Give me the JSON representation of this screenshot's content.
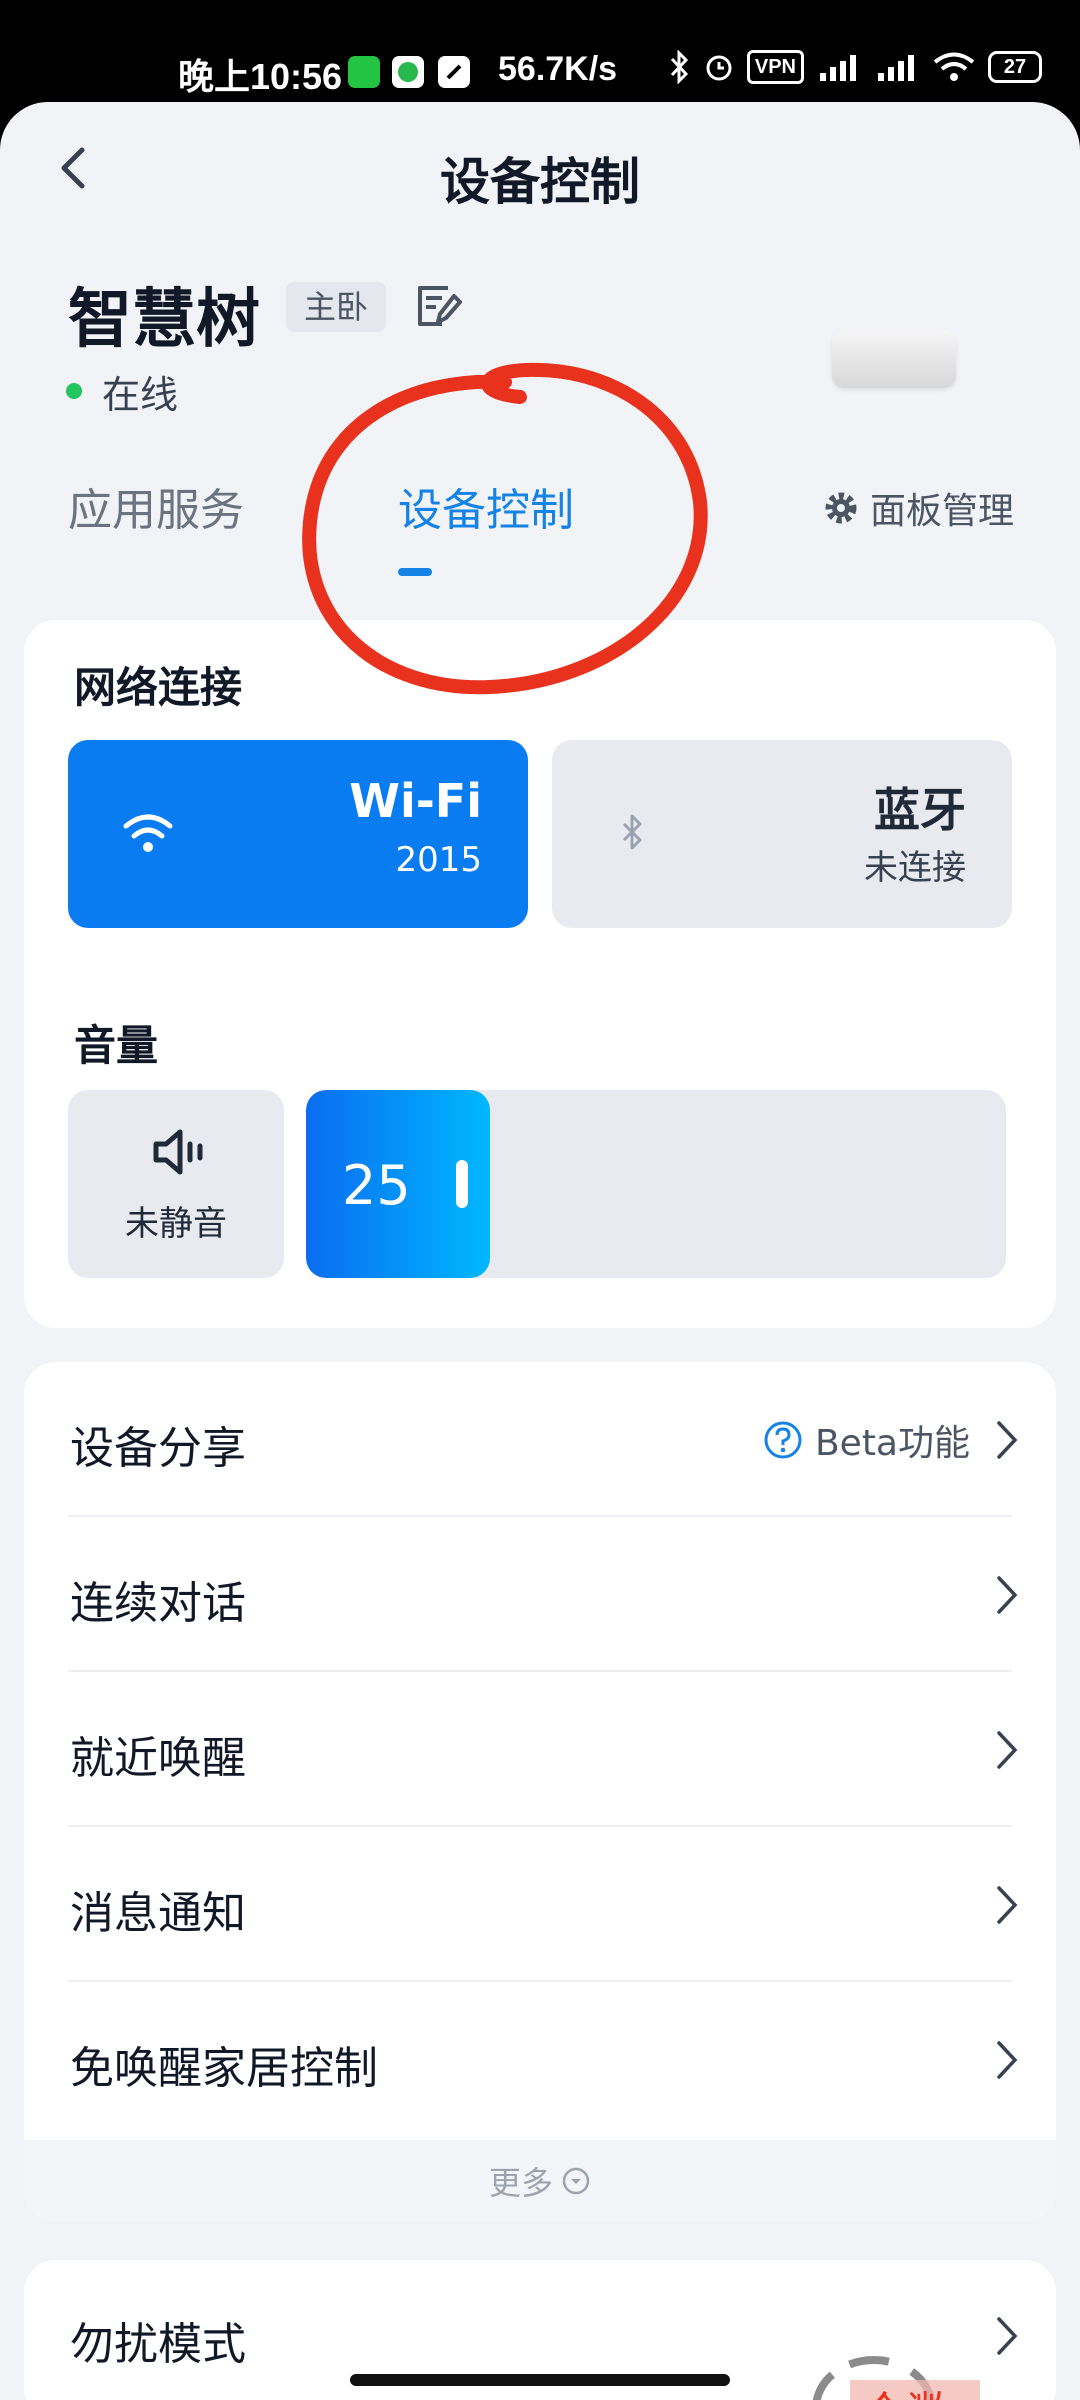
{
  "status_bar": {
    "time": "晚上10:56",
    "net_speed": "56.7K/s",
    "vpn": "VPN",
    "battery": "27",
    "icons": [
      "wechat-icon",
      "app-green-icon",
      "app-white-icon",
      "bluetooth-icon",
      "alarm-icon",
      "vpn-icon",
      "signal-hd-icon",
      "signal-hd-icon",
      "wifi-icon",
      "battery-icon"
    ]
  },
  "header": {
    "title": "设备控制",
    "back_icon": "chevron-left-icon"
  },
  "device": {
    "name": "智慧树",
    "room": "主卧",
    "status": "在线",
    "status_color": "#22c55e"
  },
  "tabs": [
    {
      "label": "应用服务",
      "active": false
    },
    {
      "label": "设备控制",
      "active": true
    }
  ],
  "panel_manage": {
    "label": "面板管理",
    "icon": "gear-icon"
  },
  "network": {
    "title": "网络连接",
    "wifi": {
      "name": "Wi-Fi",
      "sub": "2015",
      "active": true,
      "icon": "wifi-icon"
    },
    "bluetooth": {
      "name": "蓝牙",
      "sub": "未连接",
      "active": false,
      "icon": "bluetooth-icon"
    }
  },
  "volume": {
    "title": "音量",
    "mute_label": "未静音",
    "mute_icon": "speaker-icon",
    "value": "25",
    "level_fraction": 0.25
  },
  "settings_list": {
    "items": [
      {
        "label": "设备分享",
        "badge": "Beta功能"
      },
      {
        "label": "连续对话"
      },
      {
        "label": "就近唤醒"
      },
      {
        "label": "消息通知"
      },
      {
        "label": "免唤醒家居控制"
      }
    ],
    "more": "更多"
  },
  "dnd": {
    "label": "勿扰模式"
  },
  "colors": {
    "accent": "#1583e6",
    "wifi_bg": "#0a7cf2",
    "background": "#f1f3f7",
    "annotation": "#e8321e"
  }
}
